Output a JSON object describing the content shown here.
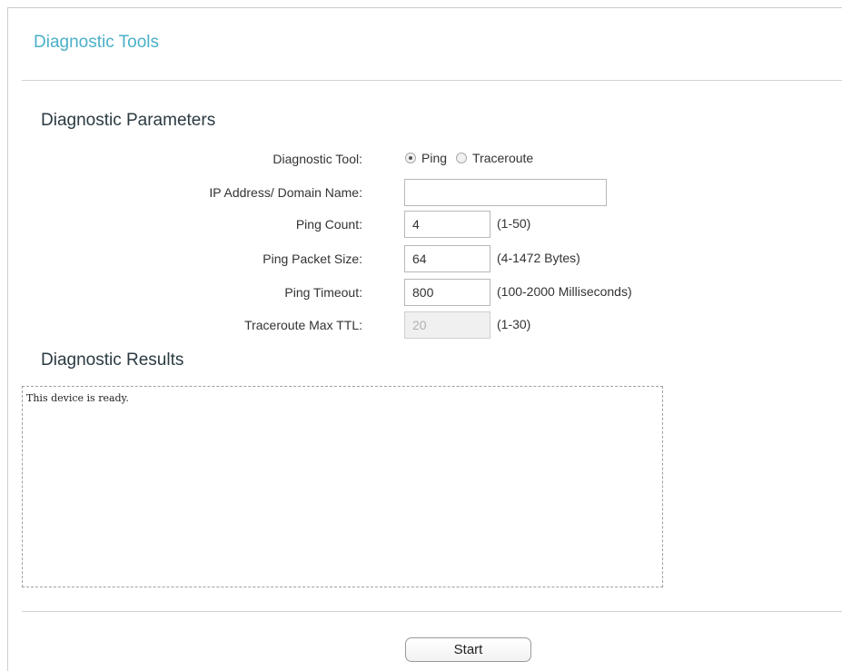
{
  "page": {
    "title": "Diagnostic Tools"
  },
  "parameters": {
    "title": "Diagnostic Parameters",
    "diagnostic_tool": {
      "label": "Diagnostic Tool:",
      "options": [
        {
          "label": "Ping",
          "checked": true
        },
        {
          "label": "Traceroute",
          "checked": false
        }
      ]
    },
    "ip_address": {
      "label": "IP Address/ Domain Name:",
      "value": ""
    },
    "ping_count": {
      "label": "Ping Count:",
      "value": "4",
      "hint": "(1-50)"
    },
    "ping_packet_size": {
      "label": "Ping Packet Size:",
      "value": "64",
      "hint": "(4-1472 Bytes)"
    },
    "ping_timeout": {
      "label": "Ping Timeout:",
      "value": "800",
      "hint": "(100-2000 Milliseconds)"
    },
    "traceroute_max_ttl": {
      "label": "Traceroute Max TTL:",
      "value": "20",
      "hint": "(1-30)",
      "disabled": true
    }
  },
  "results": {
    "title": "Diagnostic Results",
    "output": "This device is ready."
  },
  "actions": {
    "start_label": "Start"
  },
  "colors": {
    "title_accent": "#4ab0c8",
    "section_heading": "#2b3a42"
  }
}
